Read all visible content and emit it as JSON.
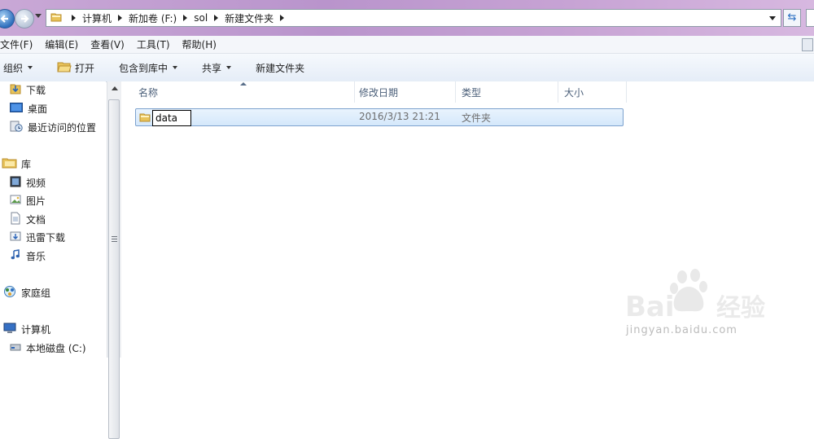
{
  "address_bar": {
    "crumbs": [
      "计算机",
      "新加卷 (F:)",
      "sol",
      "新建文件夹"
    ]
  },
  "menu": {
    "items": [
      "文件(F)",
      "编辑(E)",
      "查看(V)",
      "工具(T)",
      "帮助(H)"
    ]
  },
  "toolbar": {
    "organize": "组织",
    "open": "打开",
    "include_in_library": "包含到库中",
    "share": "共享",
    "new_folder": "新建文件夹"
  },
  "nav_pane": {
    "favorites": [
      "下载",
      "桌面",
      "最近访问的位置"
    ],
    "libraries_header": "库",
    "libraries": [
      "视频",
      "图片",
      "文档",
      "迅雷下载",
      "音乐"
    ],
    "homegroup": "家庭组",
    "computer_header": "计算机",
    "computer": [
      "本地磁盘 (C:)"
    ]
  },
  "file_list": {
    "columns": [
      "名称",
      "修改日期",
      "类型",
      "大小"
    ],
    "rows": [
      {
        "name": "data",
        "modified": "2016/3/13 21:21",
        "type": "文件夹",
        "size": ""
      }
    ]
  },
  "watermark": {
    "logo_text": "Bai 经验",
    "url": "jingyan.baidu.com"
  },
  "colors": {
    "selection_bg": "#d5e8fb",
    "selection_border": "#7da2ce",
    "header_text": "#4c607a",
    "title_bar": "#b994cc"
  }
}
